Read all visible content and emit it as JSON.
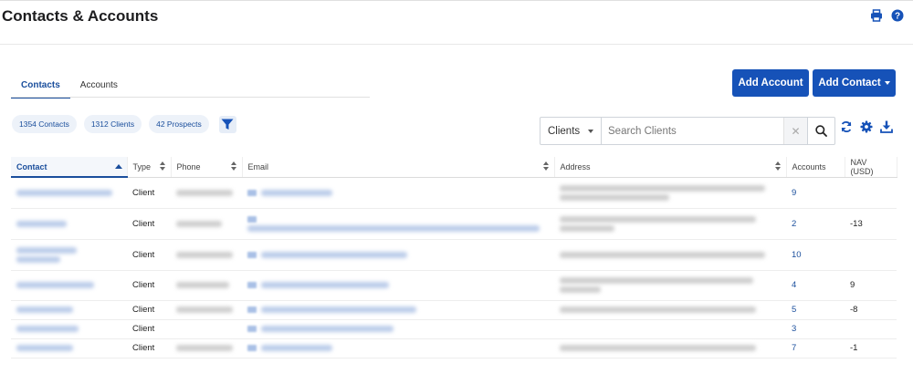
{
  "header": {
    "title": "Contacts & Accounts"
  },
  "tabs": [
    {
      "label": "Contacts",
      "active": true
    },
    {
      "label": "Accounts",
      "active": false
    }
  ],
  "actions": {
    "add_account": "Add Account",
    "add_contact": "Add Contact"
  },
  "chips": {
    "contacts": "1354 Contacts",
    "clients": "1312 Clients",
    "prospects": "42 Prospects"
  },
  "search": {
    "scope": "Clients",
    "placeholder": "Search Clients",
    "value": ""
  },
  "table": {
    "columns": [
      "Contact",
      "Type",
      "Phone",
      "Email",
      "Address",
      "Accounts",
      "NAV (USD)"
    ],
    "sorted_column": "Contact",
    "rows": [
      {
        "type": "Client",
        "accounts": "9",
        "nav": ""
      },
      {
        "type": "Client",
        "accounts": "2",
        "nav": "-13"
      },
      {
        "type": "Client",
        "accounts": "10",
        "nav": ""
      },
      {
        "type": "Client",
        "accounts": "4",
        "nav": "9"
      },
      {
        "type": "Client",
        "accounts": "5",
        "nav": "-8"
      },
      {
        "type": "Client",
        "accounts": "3",
        "nav": ""
      },
      {
        "type": "Client",
        "accounts": "7",
        "nav": "-1"
      }
    ]
  },
  "colors": {
    "primary": "#1652b8",
    "link": "#1a4e9c",
    "chip_bg": "#edf2f9"
  },
  "icons": [
    "print-icon",
    "help-icon",
    "filter-icon",
    "search-icon",
    "refresh-icon",
    "gear-icon",
    "download-icon",
    "clear-icon"
  ]
}
